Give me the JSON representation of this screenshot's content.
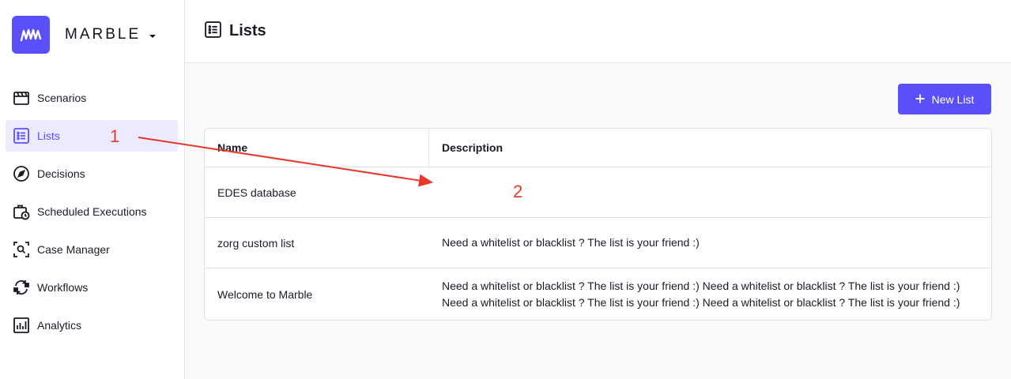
{
  "brand": {
    "name": "MARBLE"
  },
  "sidebar": {
    "items": [
      {
        "label": "Scenarios",
        "icon": "clapperboard-icon",
        "active": false
      },
      {
        "label": "Lists",
        "icon": "list-icon",
        "active": true
      },
      {
        "label": "Decisions",
        "icon": "compass-icon",
        "active": false
      },
      {
        "label": "Scheduled Executions",
        "icon": "briefcase-clock-icon",
        "active": false
      },
      {
        "label": "Case Manager",
        "icon": "scan-search-icon",
        "active": false
      },
      {
        "label": "Workflows",
        "icon": "workflow-icon",
        "active": false
      },
      {
        "label": "Analytics",
        "icon": "analytics-icon",
        "active": false
      }
    ]
  },
  "header": {
    "title": "Lists",
    "icon": "list-icon"
  },
  "toolbar": {
    "new_list_label": "New List"
  },
  "table": {
    "columns": [
      "Name",
      "Description"
    ],
    "rows": [
      {
        "name": "EDES database",
        "description": ""
      },
      {
        "name": "zorg custom list",
        "description": "Need a whitelist or blacklist ? The list is your friend :)"
      },
      {
        "name": "Welcome to Marble",
        "description": "Need a whitelist or blacklist ? The list is your friend :) Need a whitelist or blacklist ? The list is your friend :) Need a whitelist or blacklist ? The list is your friend :) Need a whitelist or blacklist ? The list is your friend :)"
      }
    ]
  },
  "annotations": {
    "marker_1": "1",
    "marker_2": "2",
    "color": "#e8372a"
  },
  "colors": {
    "accent": "#5a50fa",
    "active_bg": "#ebeaff"
  }
}
